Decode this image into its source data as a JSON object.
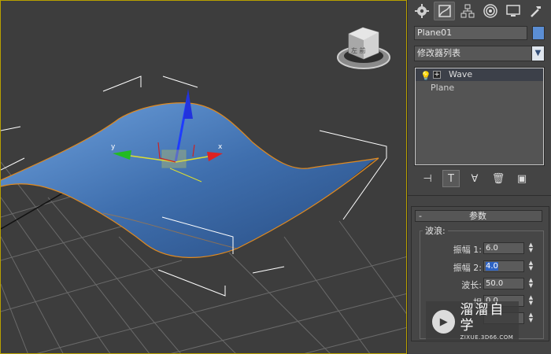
{
  "viewport": {
    "axis_x": "x",
    "axis_y": "y",
    "viewcube_face_label": "左 前"
  },
  "tabs": [
    {
      "icon": "create-icon"
    },
    {
      "icon": "modify-icon"
    },
    {
      "icon": "hierarchy-icon"
    },
    {
      "icon": "motion-icon"
    },
    {
      "icon": "display-icon"
    },
    {
      "icon": "utilities-icon"
    }
  ],
  "object": {
    "name": "Plane01",
    "color": "#5b8ed4"
  },
  "modifier_list": {
    "label": "修改器列表"
  },
  "stack": {
    "items": [
      {
        "label": "Wave",
        "selected": true
      },
      {
        "label": "Plane",
        "selected": false
      }
    ]
  },
  "rollout": {
    "collapse_symbol": "-",
    "title": "参数",
    "group_label": "波浪:",
    "params": [
      {
        "label": "振幅 1:",
        "value": "6.0"
      },
      {
        "label": "振幅 2:",
        "value": "4.0"
      },
      {
        "label": "波长:",
        "value": "50.0"
      },
      {
        "label": "相",
        "value": "0.0"
      }
    ]
  },
  "watermark": {
    "title": "溜溜自学",
    "url": "ZIXUE.3D66.COM"
  }
}
